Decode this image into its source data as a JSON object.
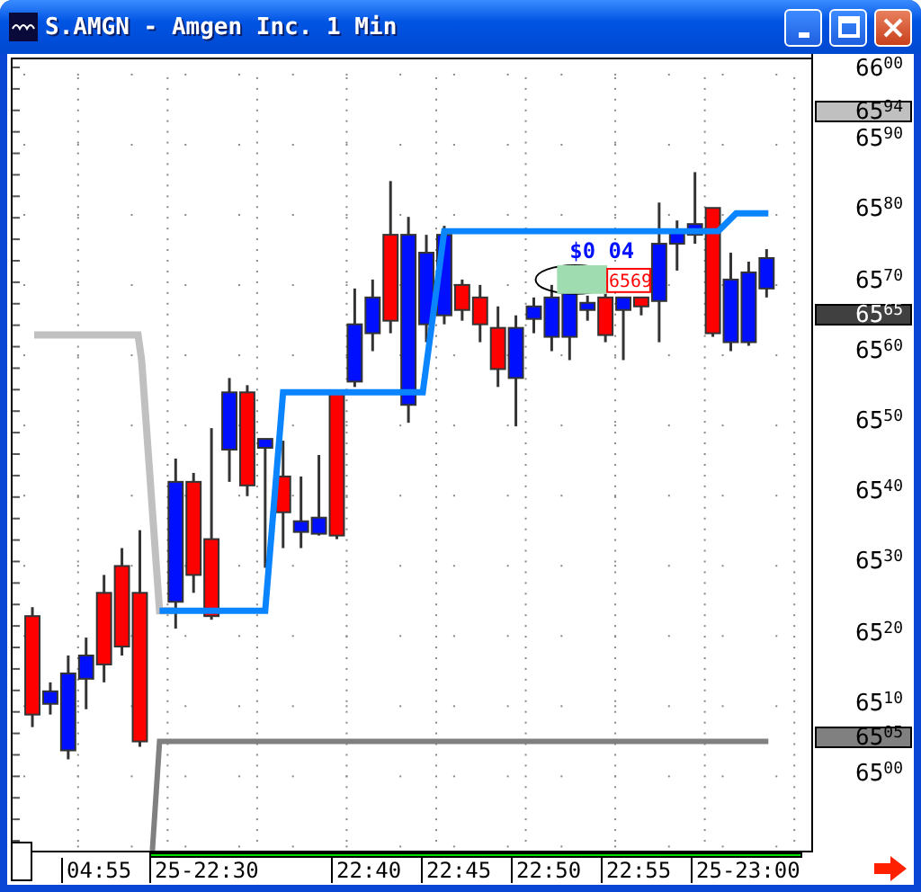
{
  "window": {
    "title": "S.AMGN - Amgen Inc. 1 Min"
  },
  "price_axis": {
    "labels": [
      "66$^{00}$",
      "65$^{90}$",
      "65$^{80}$",
      "65$^{70}$",
      "65$^{60}$",
      "65$^{50}$",
      "65$^{40}$",
      "65$^{30}$",
      "65$^{20}$",
      "65$^{10}$",
      "65$^{00}$"
    ],
    "markers": [
      {
        "label": "65$^{94}$",
        "color": "#c0c0c0"
      },
      {
        "label": "65$^{65}$",
        "color": "#404040"
      },
      {
        "label": "65$^{05}$",
        "color": "#808080"
      }
    ]
  },
  "annotation": {
    "change": "$0 04",
    "price": "6569"
  },
  "time_axis": {
    "labels": [
      "04:55",
      "25-22:30",
      "22:40",
      "22:45",
      "22:50",
      "22:55",
      "25-23:00"
    ]
  }
}
